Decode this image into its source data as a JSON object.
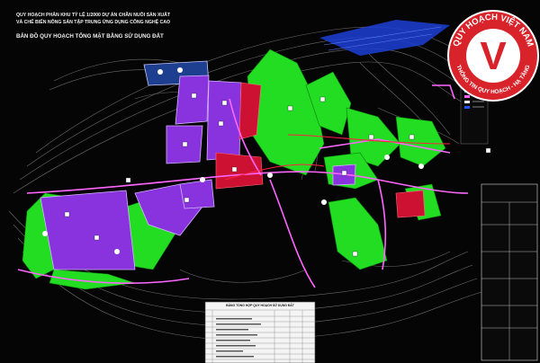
{
  "title": {
    "line1": "QUY HOẠCH PHÂN KHU TỶ LỆ 1/2000 DỰ ÁN CHĂN NUÔI SẢN XUẤT",
    "line2": "VÀ CHẾ BIẾN NÔNG SẢN TẬP TRUNG ỨNG DỤNG CÔNG NGHỆ CAO",
    "map_name": "BẢN ĐỒ QUY HOẠCH TỔNG MẶT BẰNG SỬ DỤNG ĐẤT"
  },
  "badge": {
    "top_text": "QUY HOẠCH VIỆT NAM",
    "bottom_text": "THÔNG TIN QUY HOẠCH - HẠ TẦNG",
    "letter": "V"
  },
  "land_table": {
    "title": "BẢNG TỔNG HỢP QUY HOẠCH SỬ DỤNG ĐẤT"
  },
  "colors": {
    "background": "#050505",
    "green_zone": "#22dd22",
    "purple_zone": "#8833dd",
    "red_zone": "#cc1133",
    "water": "#2255ff",
    "roads": "#ff66ff",
    "contours": "#9a9a9a",
    "badge_red": "#d8232a"
  }
}
